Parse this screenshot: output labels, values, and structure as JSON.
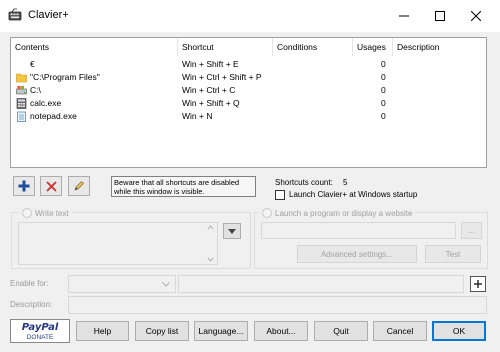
{
  "window": {
    "title": "Clavier+",
    "controls": {
      "minimize": "—",
      "maximize": "☐",
      "close": "✕"
    }
  },
  "list": {
    "columns": [
      "Contents",
      "Shortcut",
      "Conditions",
      "Usages",
      "Description"
    ],
    "rows": [
      {
        "icon": "none",
        "contents": "€",
        "shortcut": "Win + Shift + E",
        "usages": "0"
      },
      {
        "icon": "folder-icon",
        "contents": "\"C:\\Program Files\"",
        "shortcut": "Win + Ctrl + Shift + P",
        "usages": "0"
      },
      {
        "icon": "drive-icon",
        "contents": "C:\\",
        "shortcut": "Win + Ctrl + C",
        "usages": "0"
      },
      {
        "icon": "calculator-icon",
        "contents": "calc.exe",
        "shortcut": "Win + Shift + Q",
        "usages": "0"
      },
      {
        "icon": "notepad-icon",
        "contents": "notepad.exe",
        "shortcut": "Win + N",
        "usages": "0"
      }
    ]
  },
  "toolbar": {
    "add_icon": "plus-icon",
    "delete_icon": "x-icon",
    "edit_icon": "pencil-icon"
  },
  "warning": "Beware that all shortcuts are disabled while this window is visible.",
  "shortcuts_count": {
    "label": "Shortcuts count:",
    "value": "5"
  },
  "launch_at_startup": {
    "label": "Launch Clavier+ at Windows startup",
    "checked": false
  },
  "write_text": {
    "label": "Write text"
  },
  "launch_program": {
    "label": "Launch a program or display a website",
    "browse": "...",
    "advanced": "Advanced settings...",
    "test": "Test"
  },
  "enable_for": {
    "label": "Enable for:"
  },
  "description": {
    "label": "Description:"
  },
  "paypal": {
    "brand": "PayPal",
    "donate": "DONATE"
  },
  "buttons": {
    "help": "Help",
    "copy_list": "Copy list",
    "language": "Language...",
    "about": "About...",
    "quit": "Quit",
    "cancel": "Cancel",
    "ok": "OK"
  },
  "colors": {
    "add": "#1f4fa0",
    "delete": "#d03030",
    "ok_border": "#0078d7",
    "paypal_blue": "#253b80",
    "paypal_light": "#179bd7"
  }
}
